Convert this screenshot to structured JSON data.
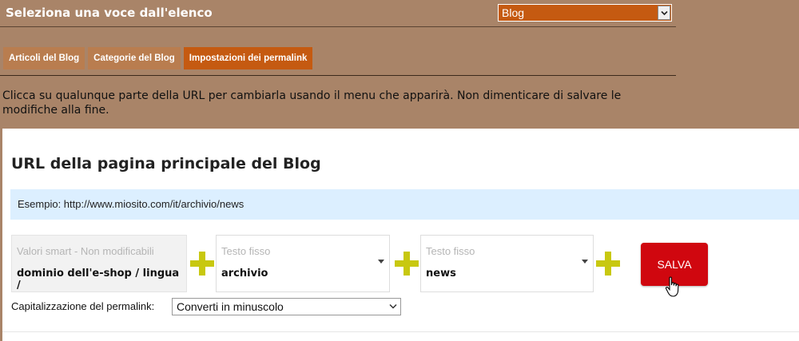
{
  "header": {
    "title": "Seleziona una voce dall'elenco",
    "blog_select_value": "Blog"
  },
  "tabs": [
    {
      "label": "Articoli del Blog",
      "active": false
    },
    {
      "label": "Categorie del Blog",
      "active": false
    },
    {
      "label": "Impostazioni dei permalink",
      "active": true
    }
  ],
  "instructions": "Clicca su qualunque parte della URL per cambiarla usando il menu che apparirà. Non dimenticare di salvare le modifiche alla fine.",
  "section": {
    "title": "URL della pagina principale del Blog",
    "example": "Esempio: http://www.miosito.com/it/archivio/news"
  },
  "segments": {
    "smart": {
      "label": "Valori smart - Non modificabili",
      "value": "dominio dell'e-shop / lingua /"
    },
    "fixed1": {
      "label": "Testo fisso",
      "value": "archivio"
    },
    "fixed2": {
      "label": "Testo fisso",
      "value": "news"
    }
  },
  "save_label": "SALVA",
  "capitalization": {
    "label": "Capitalizzazione del permalink:",
    "value": "Converti in minuscolo"
  },
  "colors": {
    "header_bg": "#a98468",
    "tab": "#b97d4f",
    "tab_active": "#c55a11",
    "example_bg": "#dcefff",
    "plus": "#c8c810",
    "save_button": "#d0070f"
  },
  "icons": [
    "select-arrow-icon",
    "caret-down-icon",
    "plus-icon",
    "hand-cursor-icon"
  ]
}
